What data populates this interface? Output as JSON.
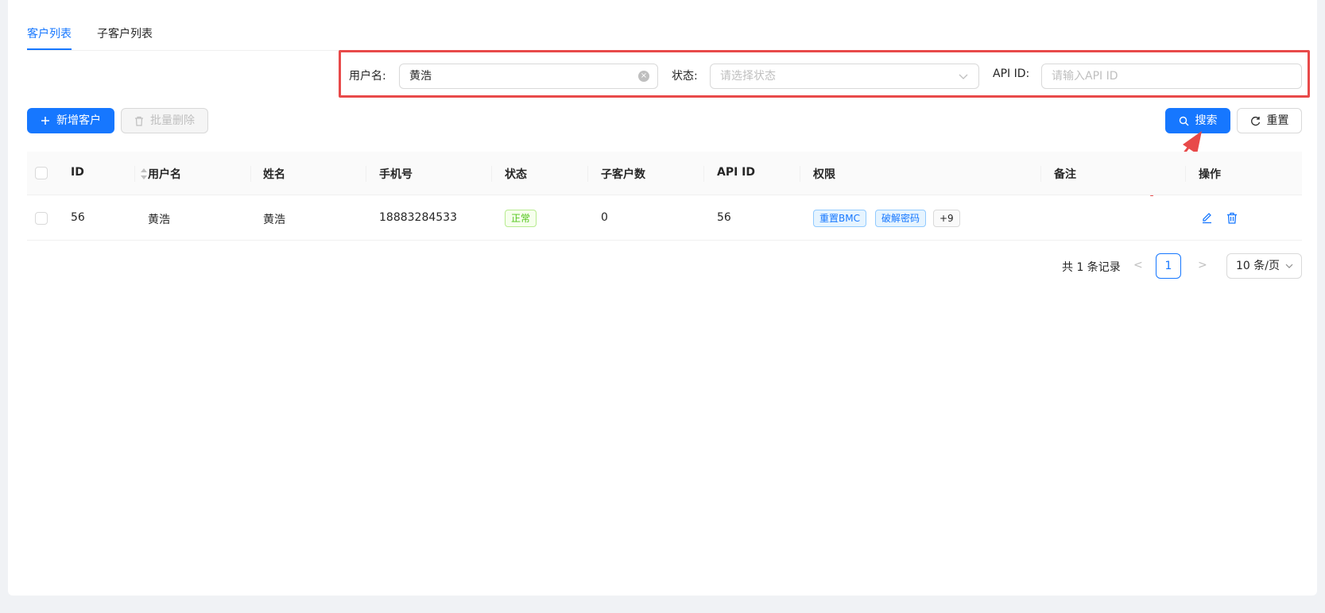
{
  "tabs": [
    {
      "label": "客户列表",
      "active": true
    },
    {
      "label": "子客户列表",
      "active": false
    }
  ],
  "search": {
    "username_label": "用户名:",
    "username_value": "黄浩",
    "status_label": "状态:",
    "status_placeholder": "请选择状态",
    "apiid_label": "API ID:",
    "apiid_placeholder": "请输入API ID"
  },
  "toolbar": {
    "add_label": "新增客户",
    "batch_delete_label": "批量删除",
    "search_label": "搜索",
    "reset_label": "重置"
  },
  "table": {
    "columns": [
      "ID",
      "用户名",
      "姓名",
      "手机号",
      "状态",
      "子客户数",
      "API ID",
      "权限",
      "备注",
      "操作"
    ],
    "rows": [
      {
        "id": "56",
        "username": "黄浩",
        "name": "黄浩",
        "phone": "18883284533",
        "status": "正常",
        "sub_count": "0",
        "api_id": "56",
        "permissions": [
          "重置BMC",
          "破解密码"
        ],
        "permissions_more": "+9",
        "remark": ""
      }
    ]
  },
  "pagination": {
    "total_text": "共 1 条记录",
    "current_page": "1",
    "page_size": "10 条/页",
    "prev": "<",
    "next": ">"
  },
  "colors": {
    "primary": "#1677ff",
    "highlight_border": "#e84a4a",
    "success": "#52c41a"
  }
}
